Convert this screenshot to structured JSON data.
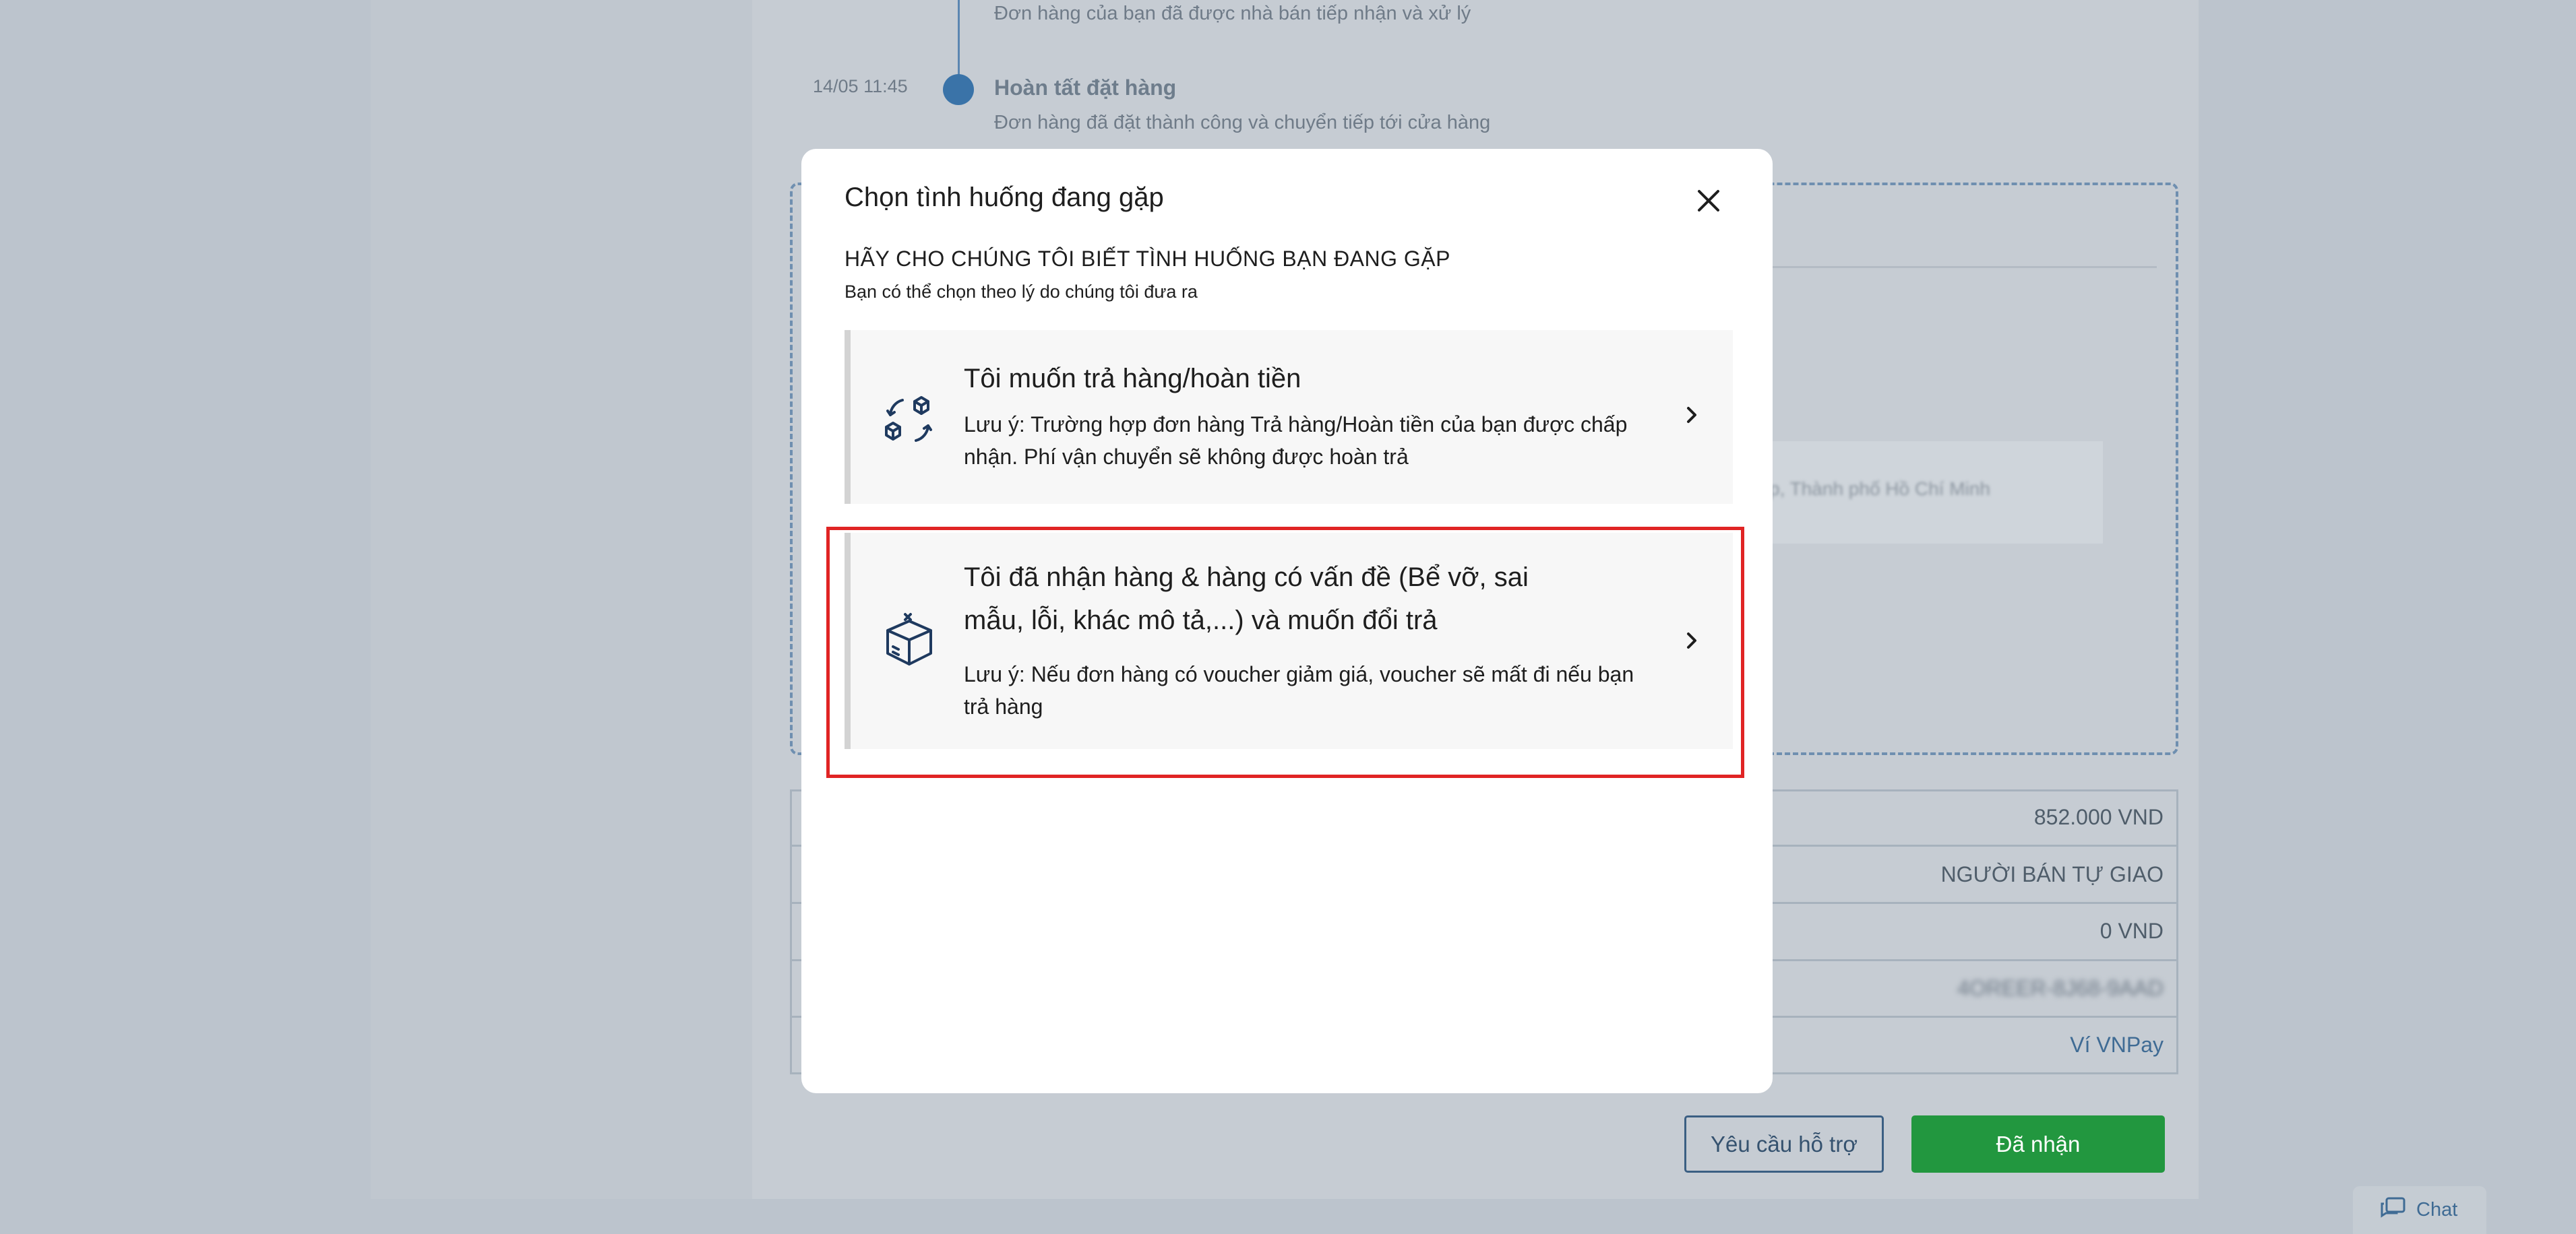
{
  "timeline": {
    "prev_desc": "Đơn hàng của bạn đã được nhà bán tiếp nhận và xử lý",
    "event_time": "14/05 11:45",
    "event_title": "Hoàn tất đặt hàng",
    "event_desc": "Đơn hàng đã đặt thành công và chuyển tiếp tới cửa hàng"
  },
  "address_blurred": "p, Thành phố Hồ Chí Minh",
  "info_values": [
    {
      "value": "852.000 VND"
    },
    {
      "value": "NGƯỜI BÁN TỰ GIAO"
    },
    {
      "value": "0 VND"
    },
    {
      "value": "4OREER-8J68-9AAD"
    },
    {
      "value": "Ví VNPay"
    }
  ],
  "buttons": {
    "support": "Yêu cầu hỗ trợ",
    "received": "Đã nhận"
  },
  "chat": {
    "label": "Chat"
  },
  "modal": {
    "title": "Chọn tình huống đang gặp",
    "heading": "HÃY CHO CHÚNG TÔI BIẾT TÌNH HUỐNG BẠN ĐANG GẶP",
    "subheading": "Bạn có thể chọn theo lý do chúng tôi đưa ra",
    "options": [
      {
        "title": "Tôi muốn trả hàng/hoàn tiền",
        "note": "Lưu ý: Trường hợp đơn hàng Trả hàng/Hoàn tiền của bạn được chấp nhận. Phí vận chuyển sẽ không được hoàn trả",
        "icon": "return-boxes-icon"
      },
      {
        "title": "Tôi đã nhận hàng & hàng có vấn đề (Bể vỡ, sai mẫu, lỗi, khác mô tả,...) và muốn đổi trả",
        "note": "Lưu ý: Nếu đơn hàng có voucher giảm giá, voucher sẽ mất đi nếu bạn trả hàng",
        "icon": "damaged-box-icon"
      }
    ]
  },
  "colors": {
    "accent_green": "#22973f",
    "link_blue": "#3f6b94",
    "highlight_red": "#e02424",
    "icon_navy": "#1f3a5f"
  }
}
